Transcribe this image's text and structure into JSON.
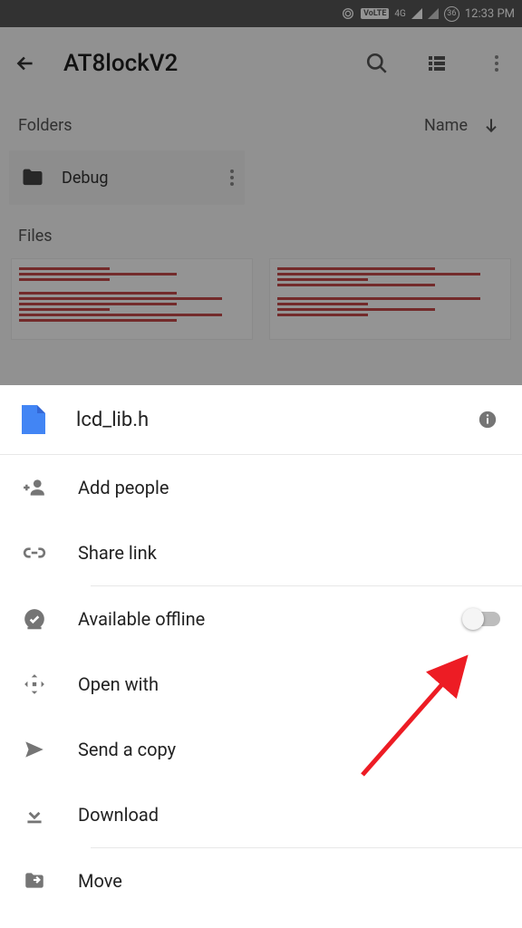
{
  "status": {
    "volte": "VoLTE",
    "net": "4G",
    "battery": "36",
    "time": "12:33 PM"
  },
  "appbar": {
    "title": "AT8lockV2"
  },
  "list_header": {
    "folders_label": "Folders",
    "sort_label": "Name",
    "files_label": "Files"
  },
  "folder": {
    "name": "Debug"
  },
  "sheet": {
    "filename": "lcd_lib.h",
    "items": {
      "add_people": "Add people",
      "share_link": "Share link",
      "available_offline": "Available offline",
      "open_with": "Open with",
      "send_copy": "Send a copy",
      "download": "Download",
      "move": "Move"
    },
    "offline_enabled": false
  }
}
